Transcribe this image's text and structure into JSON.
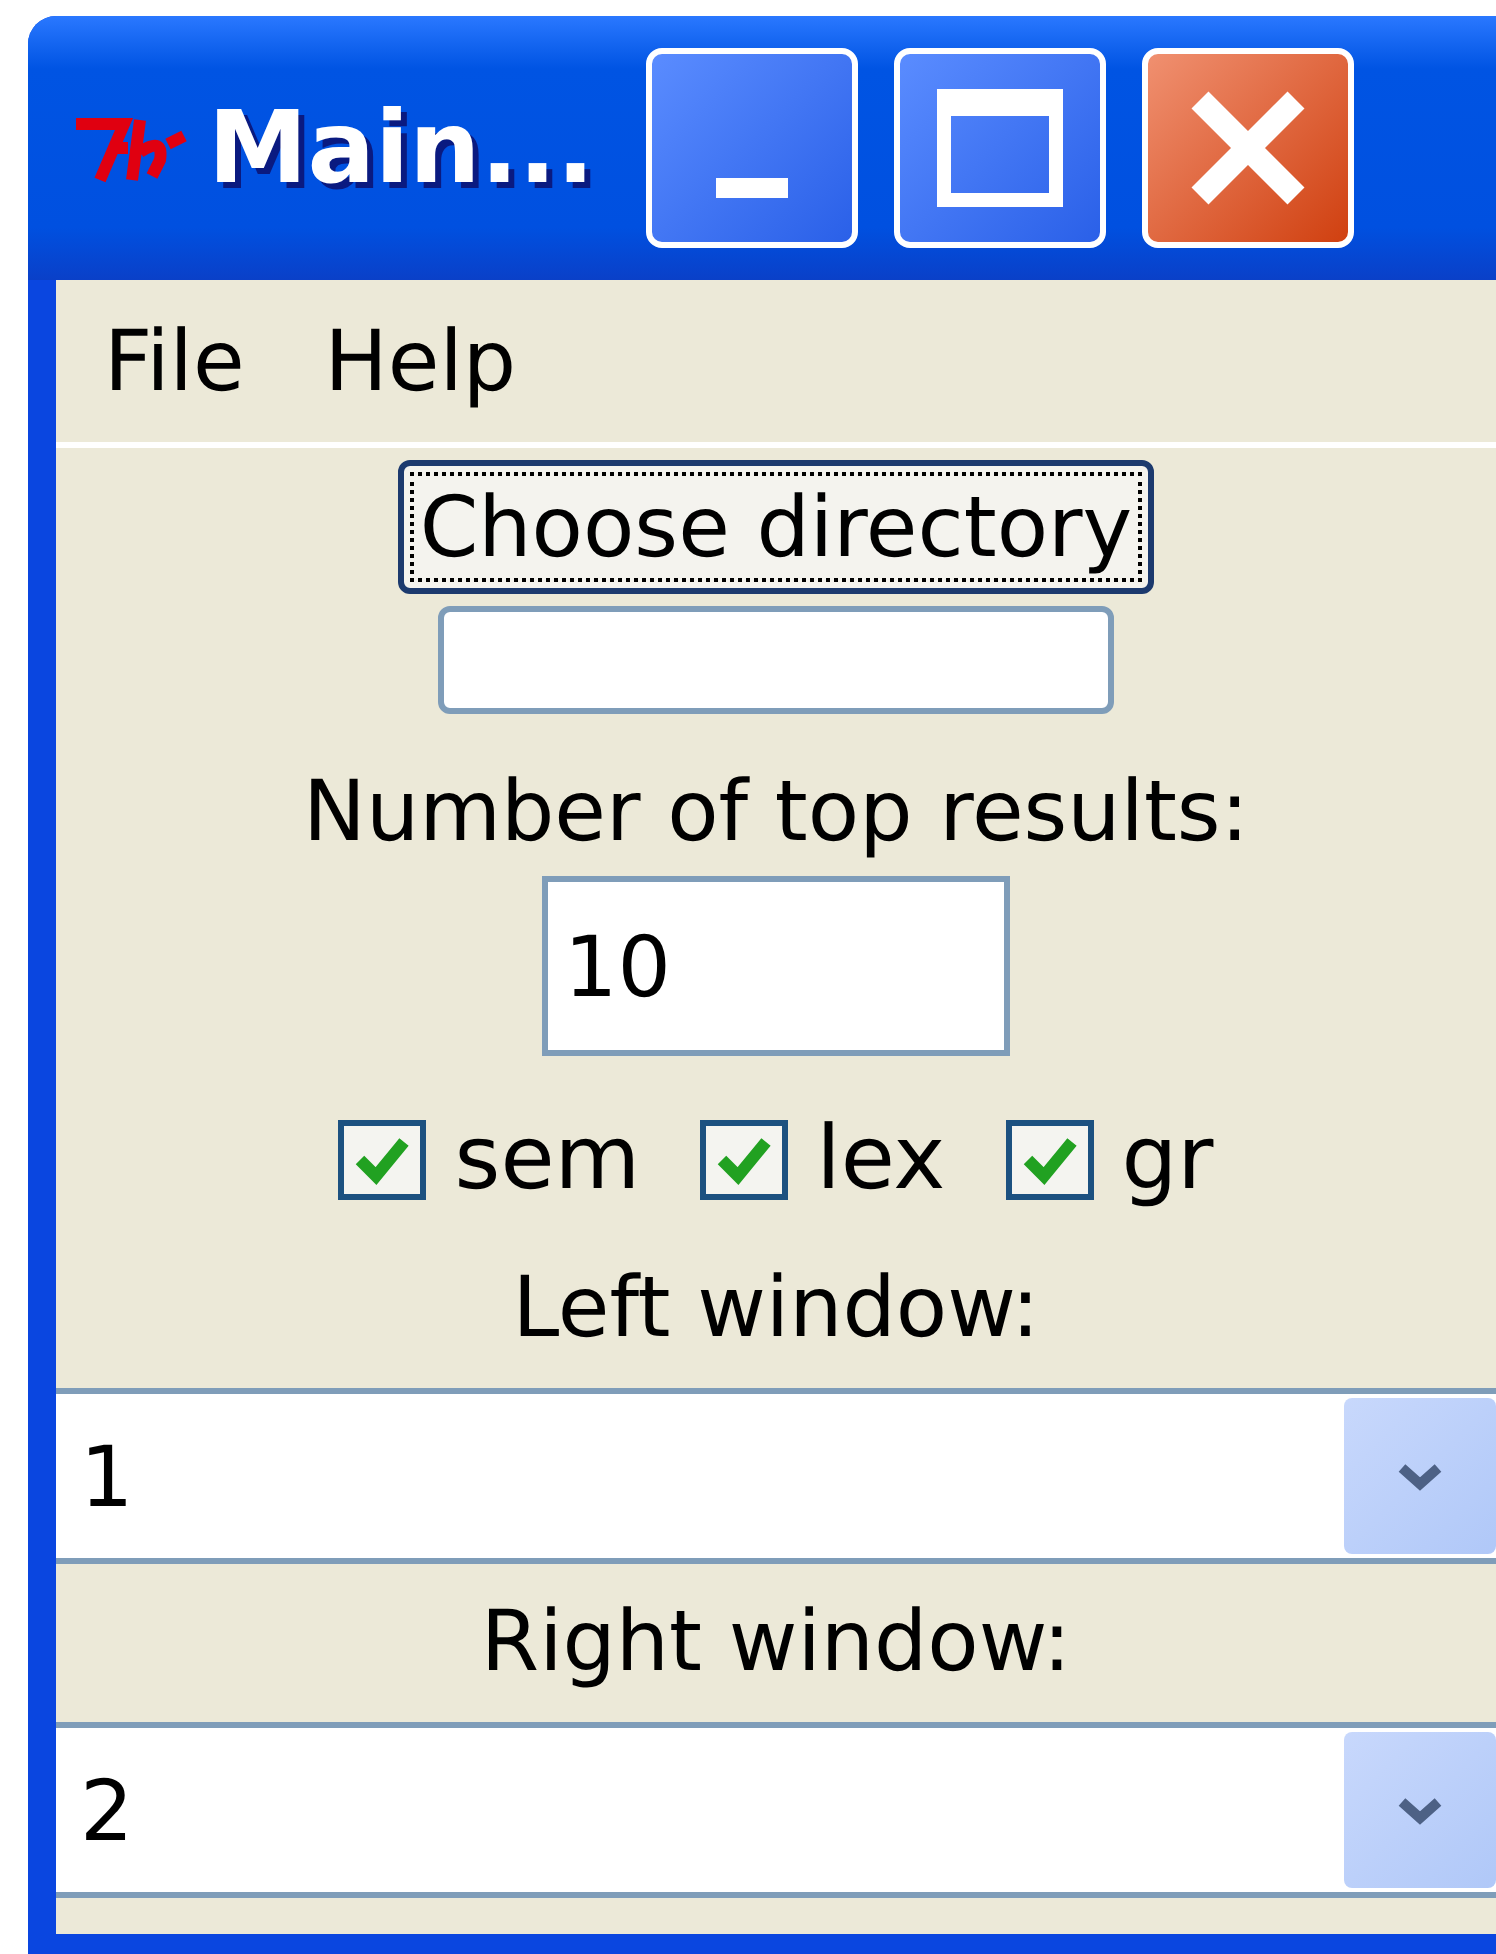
{
  "window": {
    "title": "Main..."
  },
  "menu": [
    "File",
    "Help"
  ],
  "choose_button": {
    "label": "Choose directory"
  },
  "top_results": {
    "label": "Number of top results:",
    "value": "10"
  },
  "options": [
    {
      "label": "sem",
      "checked": true
    },
    {
      "label": "lex",
      "checked": true
    },
    {
      "label": "gr",
      "checked": true
    }
  ],
  "left_window": {
    "label": "Left window:",
    "value": "1"
  },
  "right_window": {
    "label": "Right window:",
    "value": "2"
  }
}
